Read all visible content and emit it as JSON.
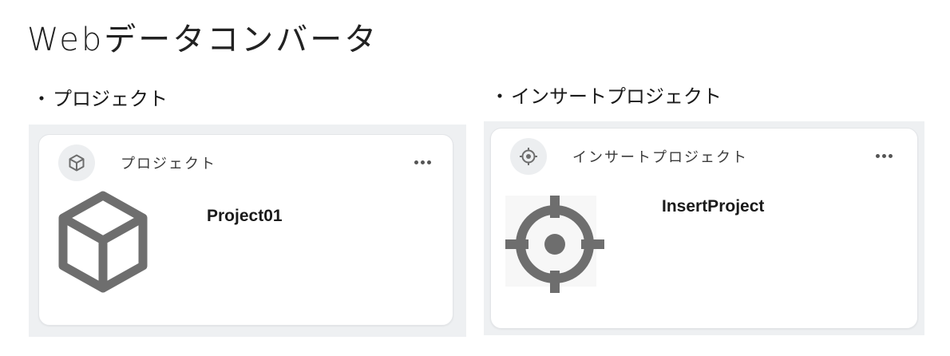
{
  "page": {
    "title": "Webデータコンバータ"
  },
  "sections": {
    "left": {
      "bullet": "・",
      "heading": "プロジェクト",
      "card": {
        "label": "プロジェクト",
        "item_title": "Project01",
        "avatar_icon": "cube-icon",
        "big_icon": "cube-icon",
        "menu_icon": "more-horizontal-icon"
      }
    },
    "right": {
      "bullet": "・",
      "heading": "インサートプロジェクト",
      "card": {
        "label": "インサートプロジェクト",
        "item_title": "InsertProject",
        "avatar_icon": "crosshair-icon",
        "big_icon": "crosshair-icon",
        "menu_icon": "more-horizontal-icon"
      }
    }
  },
  "colors": {
    "panel_background": "#eef0f2",
    "card_background": "#ffffff",
    "icon_gray": "#6e6e6e",
    "avatar_background": "#eceef0"
  }
}
